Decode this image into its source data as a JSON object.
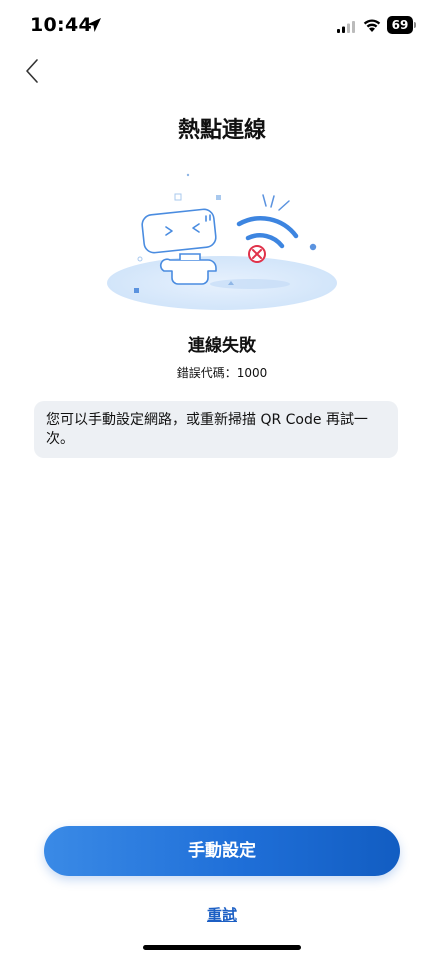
{
  "status_bar": {
    "time": "10:44",
    "battery": "69"
  },
  "header": {
    "title": "熱點連線"
  },
  "main": {
    "status_heading": "連線失敗",
    "error_code": "錯誤代碼：1000",
    "info_text": "您可以手動設定網路，或重新掃描 QR Code 再試一次。"
  },
  "actions": {
    "primary_label": "手動設定",
    "retry_label": "重試"
  },
  "colors": {
    "accent": "#1f6fd8",
    "link": "#1c5fc4",
    "info_bg": "#edf0f4",
    "error": "#e0324a"
  }
}
